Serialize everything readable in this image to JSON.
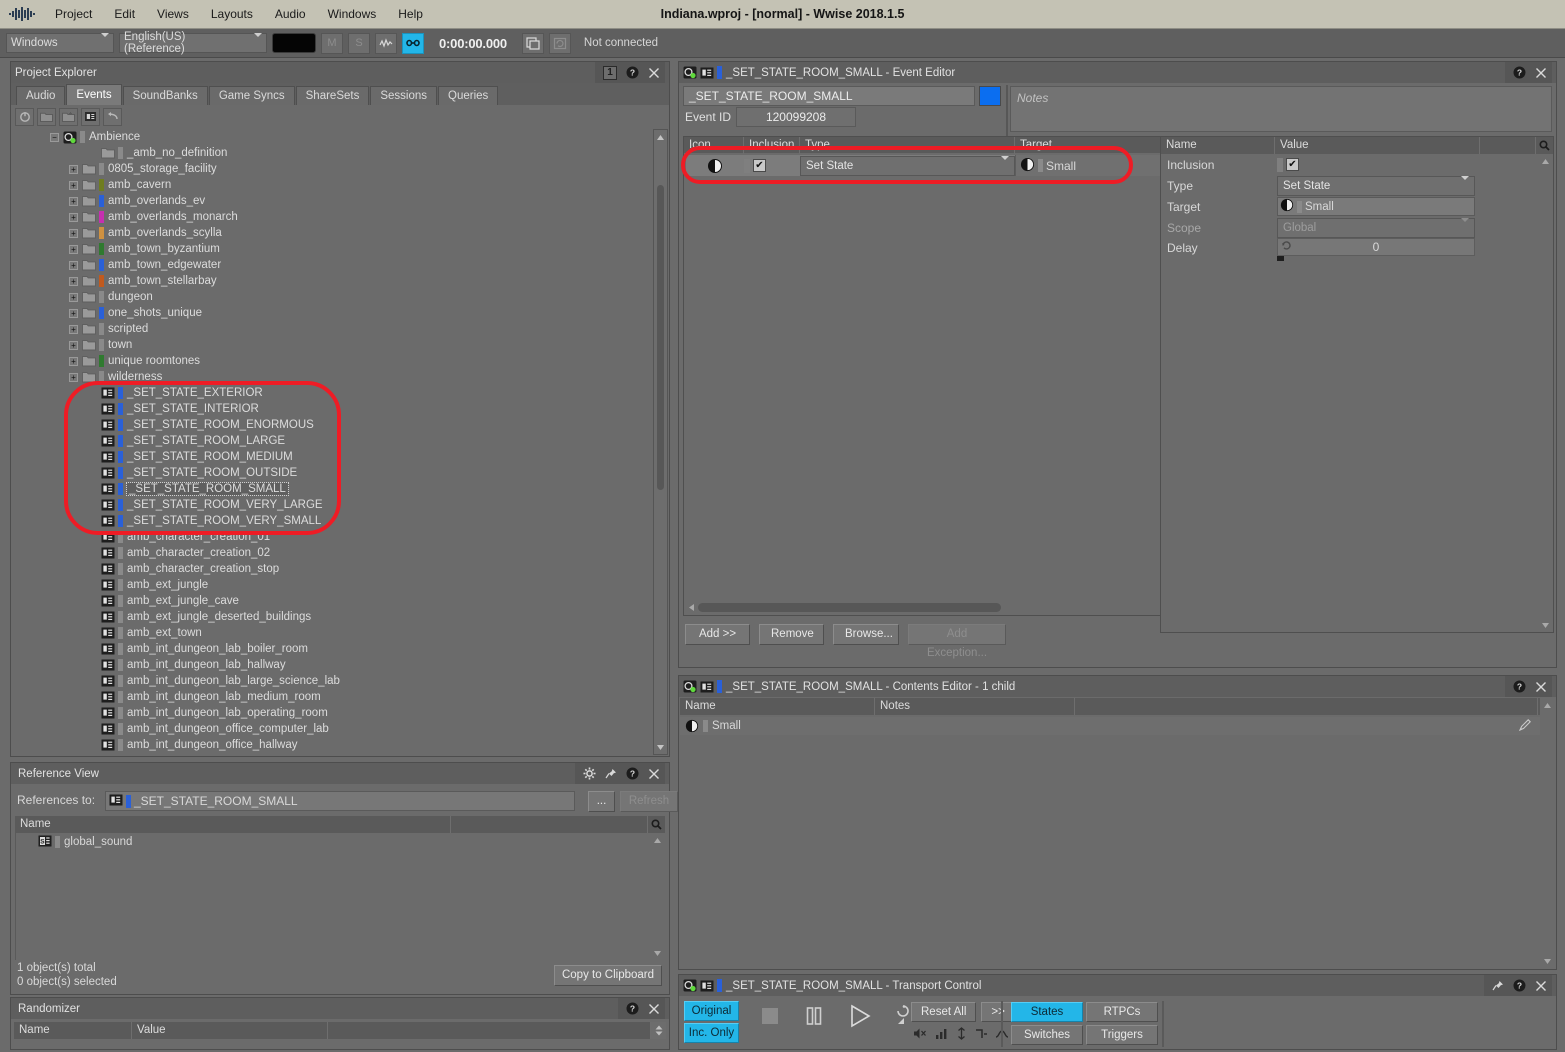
{
  "titlebar": {
    "title": "Indiana.wproj - [normal] - Wwise 2018.1.5",
    "logo_icon": "wwise-logo-icon"
  },
  "menubar": {
    "items": [
      "Project",
      "Edit",
      "Views",
      "Layouts",
      "Audio",
      "Windows",
      "Help"
    ]
  },
  "toolbar": {
    "platform": "Windows",
    "language": "English(US) (Reference)",
    "mute_label": "M",
    "solo_label": "S",
    "meter_icon": "waveform-icon",
    "link_icon": "link-icon",
    "timecode": "0:00:00.000",
    "remote_icon": "remote-connect-icon",
    "sync_icon": "sync-icon",
    "connection_status": "Not connected"
  },
  "project_explorer": {
    "title": "Project Explorer",
    "badge": "1",
    "help_icon": "help-icon",
    "close_icon": "close-icon",
    "tabs": [
      "Audio",
      "Events",
      "SoundBanks",
      "Game Syncs",
      "ShareSets",
      "Sessions",
      "Queries"
    ],
    "selected_tab": "Events",
    "toolbar_icons": [
      "refresh-icon",
      "new-folder-icon",
      "new-workunit-icon",
      "new-event-icon",
      "undo-icon"
    ],
    "tree": [
      {
        "label": "Ambience",
        "indent": 2,
        "expander": "minus",
        "icon": "workunit-icon",
        "color": "#8a8a8a"
      },
      {
        "label": "_amb_no_definition",
        "indent": 4,
        "expander": "none",
        "icon": "folder-icon",
        "color": "#8a8a8a"
      },
      {
        "label": "0805_storage_facility",
        "indent": 3,
        "expander": "plus",
        "icon": "folder-icon",
        "color": "#8a8a8a"
      },
      {
        "label": "amb_cavern",
        "indent": 3,
        "expander": "plus",
        "icon": "folder-icon",
        "color": "#6f7d1f"
      },
      {
        "label": "amb_overlands_ev",
        "indent": 3,
        "expander": "plus",
        "icon": "folder-icon",
        "color": "#2a60d8"
      },
      {
        "label": "amb_overlands_monarch",
        "indent": 3,
        "expander": "plus",
        "icon": "folder-icon",
        "color": "#c62fb0"
      },
      {
        "label": "amb_overlands_scylla",
        "indent": 3,
        "expander": "plus",
        "icon": "folder-icon",
        "color": "#cf9140"
      },
      {
        "label": "amb_town_byzantium",
        "indent": 3,
        "expander": "plus",
        "icon": "folder-icon",
        "color": "#2f7a2f"
      },
      {
        "label": "amb_town_edgewater",
        "indent": 3,
        "expander": "plus",
        "icon": "folder-icon",
        "color": "#2a60d8"
      },
      {
        "label": "amb_town_stellarbay",
        "indent": 3,
        "expander": "plus",
        "icon": "folder-icon",
        "color": "#c15a1e"
      },
      {
        "label": "dungeon",
        "indent": 3,
        "expander": "plus",
        "icon": "folder-icon",
        "color": "#8a8a8a"
      },
      {
        "label": "one_shots_unique",
        "indent": 3,
        "expander": "plus",
        "icon": "folder-icon",
        "color": "#2a60d8"
      },
      {
        "label": "scripted",
        "indent": 3,
        "expander": "plus",
        "icon": "folder-icon",
        "color": "#8a8a8a"
      },
      {
        "label": "town",
        "indent": 3,
        "expander": "plus",
        "icon": "folder-icon",
        "color": "#8a8a8a"
      },
      {
        "label": "unique roomtones",
        "indent": 3,
        "expander": "plus",
        "icon": "folder-icon",
        "color": "#2f7a2f"
      },
      {
        "label": "wilderness",
        "indent": 3,
        "expander": "plus",
        "icon": "folder-icon",
        "color": "#8a8a8a"
      },
      {
        "label": "_SET_STATE_EXTERIOR",
        "indent": 4,
        "expander": "none",
        "icon": "event-icon",
        "color": "#2a60d8"
      },
      {
        "label": "_SET_STATE_INTERIOR",
        "indent": 4,
        "expander": "none",
        "icon": "event-icon",
        "color": "#2a60d8"
      },
      {
        "label": "_SET_STATE_ROOM_ENORMOUS",
        "indent": 4,
        "expander": "none",
        "icon": "event-icon",
        "color": "#2a60d8"
      },
      {
        "label": "_SET_STATE_ROOM_LARGE",
        "indent": 4,
        "expander": "none",
        "icon": "event-icon",
        "color": "#2a60d8"
      },
      {
        "label": "_SET_STATE_ROOM_MEDIUM",
        "indent": 4,
        "expander": "none",
        "icon": "event-icon",
        "color": "#2a60d8"
      },
      {
        "label": "_SET_STATE_ROOM_OUTSIDE",
        "indent": 4,
        "expander": "none",
        "icon": "event-icon",
        "color": "#2a60d8"
      },
      {
        "label": "_SET_STATE_ROOM_SMALL",
        "indent": 4,
        "expander": "none",
        "icon": "event-icon",
        "color": "#2a60d8",
        "selected": true
      },
      {
        "label": "_SET_STATE_ROOM_VERY_LARGE",
        "indent": 4,
        "expander": "none",
        "icon": "event-icon",
        "color": "#2a60d8"
      },
      {
        "label": "_SET_STATE_ROOM_VERY_SMALL",
        "indent": 4,
        "expander": "none",
        "icon": "event-icon",
        "color": "#2a60d8"
      },
      {
        "label": "amb_character_creation_01",
        "indent": 4,
        "expander": "none",
        "icon": "event-icon",
        "color": "#8a8a8a"
      },
      {
        "label": "amb_character_creation_02",
        "indent": 4,
        "expander": "none",
        "icon": "event-icon",
        "color": "#8a8a8a"
      },
      {
        "label": "amb_character_creation_stop",
        "indent": 4,
        "expander": "none",
        "icon": "event-icon",
        "color": "#8a8a8a"
      },
      {
        "label": "amb_ext_jungle",
        "indent": 4,
        "expander": "none",
        "icon": "event-icon",
        "color": "#8a8a8a"
      },
      {
        "label": "amb_ext_jungle_cave",
        "indent": 4,
        "expander": "none",
        "icon": "event-icon",
        "color": "#8a8a8a"
      },
      {
        "label": "amb_ext_jungle_deserted_buildings",
        "indent": 4,
        "expander": "none",
        "icon": "event-icon",
        "color": "#8a8a8a"
      },
      {
        "label": "amb_ext_town",
        "indent": 4,
        "expander": "none",
        "icon": "event-icon",
        "color": "#8a8a8a"
      },
      {
        "label": "amb_int_dungeon_lab_boiler_room",
        "indent": 4,
        "expander": "none",
        "icon": "event-icon",
        "color": "#8a8a8a"
      },
      {
        "label": "amb_int_dungeon_lab_hallway",
        "indent": 4,
        "expander": "none",
        "icon": "event-icon",
        "color": "#8a8a8a"
      },
      {
        "label": "amb_int_dungeon_lab_large_science_lab",
        "indent": 4,
        "expander": "none",
        "icon": "event-icon",
        "color": "#8a8a8a"
      },
      {
        "label": "amb_int_dungeon_lab_medium_room",
        "indent": 4,
        "expander": "none",
        "icon": "event-icon",
        "color": "#8a8a8a"
      },
      {
        "label": "amb_int_dungeon_lab_operating_room",
        "indent": 4,
        "expander": "none",
        "icon": "event-icon",
        "color": "#8a8a8a"
      },
      {
        "label": "amb_int_dungeon_office_computer_lab",
        "indent": 4,
        "expander": "none",
        "icon": "event-icon",
        "color": "#8a8a8a"
      },
      {
        "label": "amb_int_dungeon_office_hallway",
        "indent": 4,
        "expander": "none",
        "icon": "event-icon",
        "color": "#8a8a8a"
      }
    ]
  },
  "event_editor": {
    "title": "_SET_STATE_ROOM_SMALL  - Event Editor",
    "object_icon": "event-icon",
    "workunit_icon": "workunit-icon",
    "color_bar": "#2a60d8",
    "name_value": "_SET_STATE_ROOM_SMALL",
    "color_swatch": "#0b6ef0",
    "event_id_label": "Event ID",
    "event_id_value": "120099208",
    "notes_placeholder": "Notes",
    "columns": [
      "Icon",
      "Inclusion",
      "Type",
      "Target"
    ],
    "search_icon": "search-icon",
    "rows": [
      {
        "icon": "state-icon",
        "inclusion": true,
        "type": "Set State",
        "target": "Small",
        "target_icon": "state-icon"
      }
    ],
    "buttons": [
      {
        "label": "Add >>",
        "disabled": false
      },
      {
        "label": "Remove",
        "disabled": false
      },
      {
        "label": "Browse...",
        "disabled": false
      },
      {
        "label": "Add Exception...",
        "disabled": true
      }
    ],
    "help_icon": "help-icon",
    "close_icon": "close-icon"
  },
  "property_panel": {
    "columns": [
      "Name",
      "Value"
    ],
    "search_icon": "search-icon",
    "rows": [
      {
        "name": "Inclusion",
        "type": "checkbox",
        "value": "checked"
      },
      {
        "name": "Type",
        "type": "dropdown",
        "value": "Set State",
        "disabled": false
      },
      {
        "name": "Target",
        "type": "object",
        "value": "Small",
        "icon": "state-icon"
      },
      {
        "name": "Scope",
        "type": "dropdown",
        "value": "Global",
        "disabled": true
      },
      {
        "name": "Delay",
        "type": "slider",
        "value": "0"
      }
    ]
  },
  "contents_editor": {
    "title": "_SET_STATE_ROOM_SMALL  - Contents Editor  - 1 child",
    "object_icon": "event-icon",
    "workunit_icon": "workunit-icon",
    "color_bar": "#2a60d8",
    "columns": [
      "Name",
      "Notes"
    ],
    "search_icon": "search-icon",
    "rows": [
      {
        "name": "Small",
        "icon": "state-icon",
        "notes": "",
        "edit_icon": "pencil-icon"
      }
    ],
    "help_icon": "help-icon",
    "close_icon": "close-icon"
  },
  "transport_control": {
    "title": "_SET_STATE_ROOM_SMALL  - Transport Control",
    "object_icon": "event-icon",
    "workunit_icon": "workunit-icon",
    "color_bar": "#2a60d8",
    "pin_icon": "pin-icon",
    "help_icon": "help-icon",
    "close_icon": "close-icon",
    "left_buttons": [
      {
        "label": "Original",
        "active": true
      },
      {
        "label": "Inc. Only",
        "active": true
      }
    ],
    "stop_icon": "stop-icon",
    "pause_icon": "pause-icon",
    "play_icon": "play-icon",
    "pitch_icon": "pitch-icon",
    "reset_label": "Reset All",
    "more_label": ">>",
    "small_icons": [
      "mute-icon",
      "volume-icon",
      "lowpass-icon",
      "highpass-icon",
      "curve-icon"
    ],
    "right_buttons": [
      {
        "label": "States",
        "active": true
      },
      {
        "label": "RTPCs",
        "active": false
      },
      {
        "label": "Switches",
        "active": false
      },
      {
        "label": "Triggers",
        "active": false
      }
    ]
  },
  "reference_view": {
    "title": "Reference View",
    "gear_icon": "gear-icon",
    "pin_icon": "pin-icon",
    "help_icon": "help-icon",
    "close_icon": "close-icon",
    "references_label": "References to:",
    "references_value": "_SET_STATE_ROOM_SMALL",
    "references_icon": "event-icon",
    "color_bar": "#2a60d8",
    "browse_label": "...",
    "refresh_label": "Refresh",
    "columns": [
      "Name"
    ],
    "search_icon": "search-icon",
    "rows": [
      {
        "name": "global_sound",
        "icon": "soundbank-icon"
      }
    ],
    "status_total": "1 object(s) total",
    "status_selected": "0 object(s) selected",
    "copy_label": "Copy to Clipboard"
  },
  "randomizer": {
    "title": "Randomizer",
    "help_icon": "help-icon",
    "close_icon": "close-icon",
    "columns": [
      "Name",
      "Value"
    ],
    "rows": []
  },
  "annotations": {
    "highlight_color": "#ee1c25"
  }
}
